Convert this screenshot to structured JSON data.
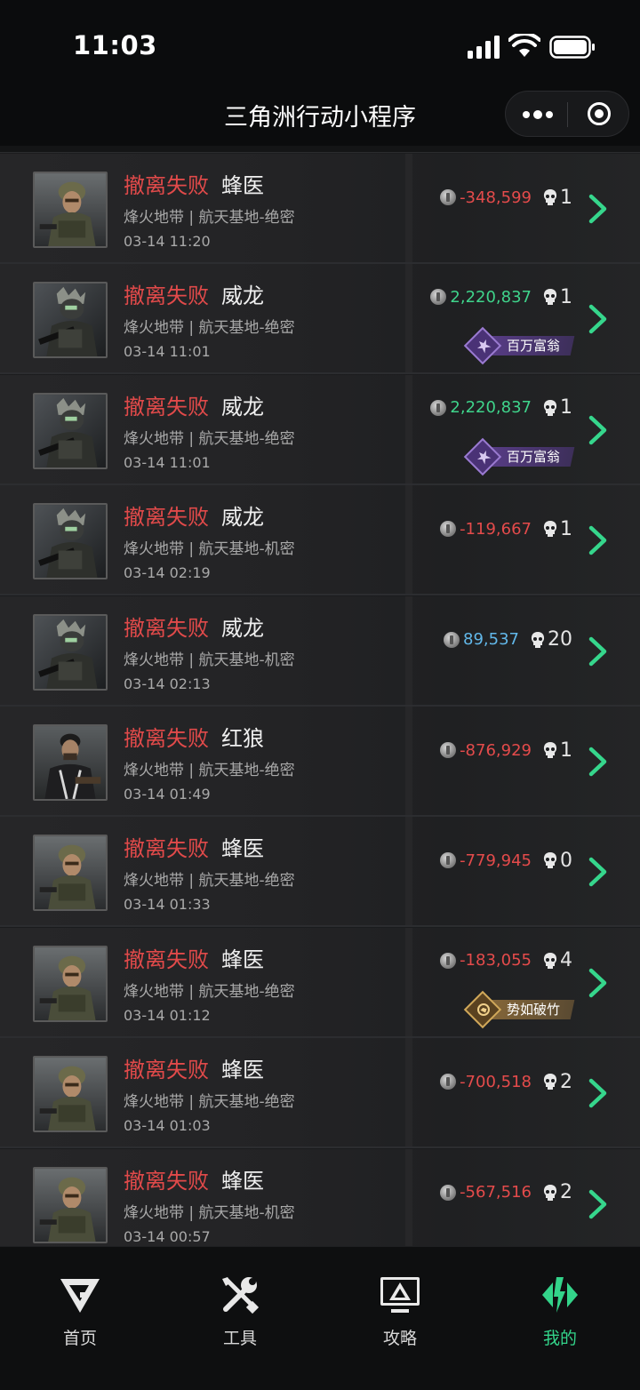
{
  "status_bar": {
    "time": "11:03"
  },
  "nav": {
    "title": "三角洲行动小程序"
  },
  "records": [
    {
      "status": "撤离失败",
      "operator": "蜂医",
      "map": "烽火地带 | 航天基地-绝密",
      "time": "03-14 11:20",
      "value": "-348,599",
      "value_color": "#e44b4b",
      "kills": "1",
      "badge": null,
      "avatar": "medic"
    },
    {
      "status": "撤离失败",
      "operator": "威龙",
      "map": "烽火地带 | 航天基地-绝密",
      "time": "03-14 11:01",
      "value": "2,220,837",
      "value_color": "#3fd48b",
      "kills": "1",
      "badge": "百万富翁",
      "badge_style": "purple",
      "avatar": "weilong"
    },
    {
      "status": "撤离失败",
      "operator": "威龙",
      "map": "烽火地带 | 航天基地-绝密",
      "time": "03-14 11:01",
      "value": "2,220,837",
      "value_color": "#3fd48b",
      "kills": "1",
      "badge": "百万富翁",
      "badge_style": "purple",
      "avatar": "weilong"
    },
    {
      "status": "撤离失败",
      "operator": "威龙",
      "map": "烽火地带 | 航天基地-机密",
      "time": "03-14 02:19",
      "value": "-119,667",
      "value_color": "#e44b4b",
      "kills": "1",
      "badge": null,
      "avatar": "weilong"
    },
    {
      "status": "撤离失败",
      "operator": "威龙",
      "map": "烽火地带 | 航天基地-机密",
      "time": "03-14 02:13",
      "value": "89,537",
      "value_color": "#62b8ea",
      "kills": "20",
      "badge": null,
      "avatar": "weilong"
    },
    {
      "status": "撤离失败",
      "operator": "红狼",
      "map": "烽火地带 | 航天基地-绝密",
      "time": "03-14 01:49",
      "value": "-876,929",
      "value_color": "#e44b4b",
      "kills": "1",
      "badge": null,
      "avatar": "redwolf"
    },
    {
      "status": "撤离失败",
      "operator": "蜂医",
      "map": "烽火地带 | 航天基地-绝密",
      "time": "03-14 01:33",
      "value": "-779,945",
      "value_color": "#e44b4b",
      "kills": "0",
      "badge": null,
      "avatar": "medic"
    },
    {
      "status": "撤离失败",
      "operator": "蜂医",
      "map": "烽火地带 | 航天基地-绝密",
      "time": "03-14 01:12",
      "value": "-183,055",
      "value_color": "#e44b4b",
      "kills": "4",
      "badge": "势如破竹",
      "badge_style": "gold",
      "avatar": "medic"
    },
    {
      "status": "撤离失败",
      "operator": "蜂医",
      "map": "烽火地带 | 航天基地-绝密",
      "time": "03-14 01:03",
      "value": "-700,518",
      "value_color": "#e44b4b",
      "kills": "2",
      "badge": null,
      "avatar": "medic"
    },
    {
      "status": "撤离失败",
      "operator": "蜂医",
      "map": "烽火地带 | 航天基地-机密",
      "time": "03-14 00:57",
      "value": "-567,516",
      "value_color": "#e44b4b",
      "kills": "2",
      "badge": null,
      "avatar": "medic"
    }
  ],
  "tabs": [
    {
      "label": "首页",
      "icon": "logo-home-icon",
      "active": false
    },
    {
      "label": "工具",
      "icon": "tools-icon",
      "active": false
    },
    {
      "label": "攻略",
      "icon": "guide-monitor-icon",
      "active": false
    },
    {
      "label": "我的",
      "icon": "profile-diamond-icon",
      "active": true
    }
  ],
  "colors": {
    "accent": "#33d48a",
    "fail": "#e14a4a",
    "negative": "#e44b4b",
    "positive": "#3fd48b",
    "info": "#62b8ea"
  }
}
